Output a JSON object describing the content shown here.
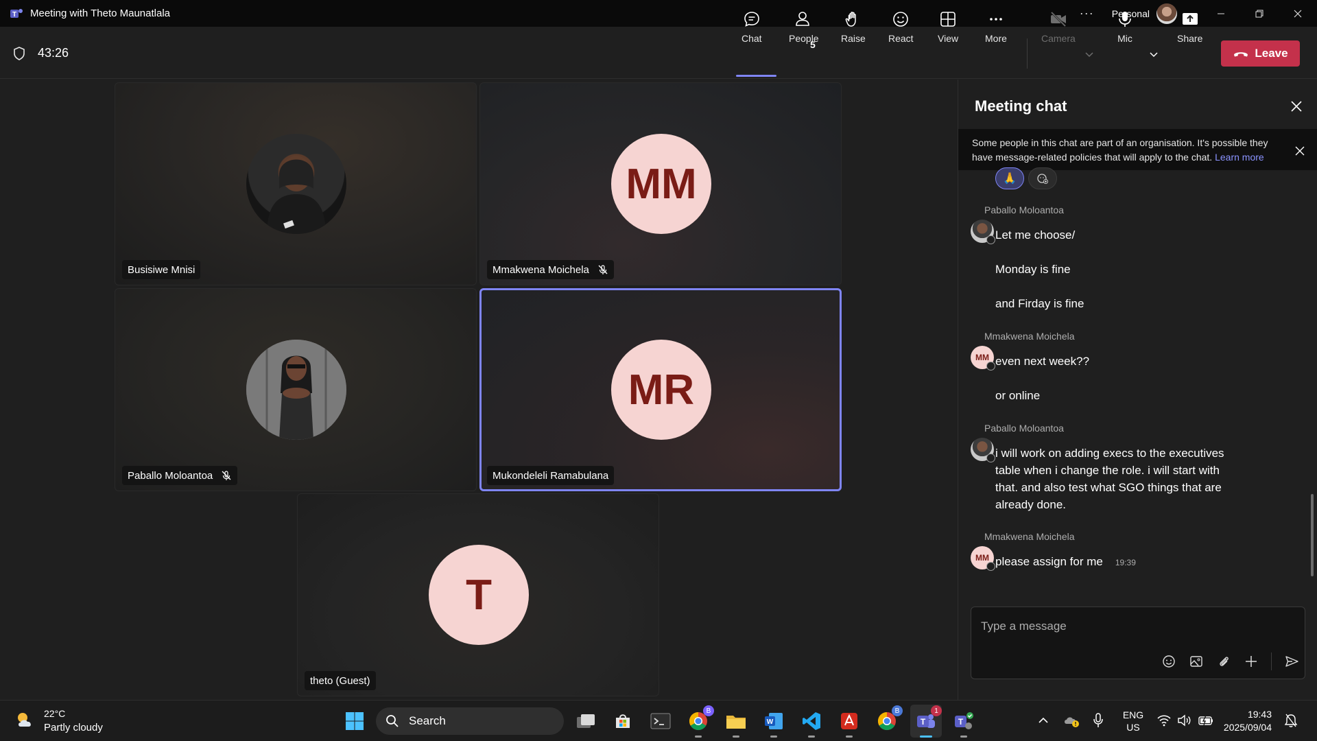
{
  "window": {
    "title": "Meeting with Theto Maunatlala",
    "more_label": "···",
    "account": "Personal"
  },
  "meeting": {
    "timer": "43:26",
    "toolbar": {
      "chat": "Chat",
      "people": "People",
      "people_count": "5",
      "raise": "Raise",
      "react": "React",
      "view": "View",
      "more": "More",
      "camera": "Camera",
      "mic": "Mic",
      "share": "Share",
      "leave": "Leave"
    }
  },
  "participants": [
    {
      "name": "Busisiwe Mnisi",
      "initials": "",
      "muted": false,
      "has_photo": true
    },
    {
      "name": "Mmakwena Moichela",
      "initials": "MM",
      "muted": true,
      "has_photo": false
    },
    {
      "name": "Paballo Moloantoa",
      "initials": "",
      "muted": true,
      "has_photo": true
    },
    {
      "name": "Mukondeleli Ramabulana",
      "initials": "MR",
      "muted": false,
      "has_photo": false,
      "speaking": true
    },
    {
      "name": "theto (Guest)",
      "initials": "T",
      "muted": false,
      "has_photo": false
    }
  ],
  "chat": {
    "title": "Meeting chat",
    "notice": "Some people in this chat are part of an organisation. It's possible they have message-related policies that will apply to the chat.",
    "notice_link": "Learn more",
    "reactions": [
      "🙏",
      "☺"
    ],
    "groups": [
      {
        "sender": "Paballo Moloantoa",
        "avatar": "photo",
        "messages": [
          "Let me choose/",
          "Monday is fine",
          "and Firday is fine"
        ]
      },
      {
        "sender": "Mmakwena Moichela",
        "avatar": "MM",
        "messages": [
          "even next week??",
          "or online"
        ]
      },
      {
        "sender": "Paballo Moloantoa",
        "avatar": "photo",
        "messages": [
          "i will work on adding execs to the executives",
          "table when i change the role. i will start with",
          "that. and also test what SGO things that are",
          "already done."
        ]
      },
      {
        "sender": "Mmakwena Moichela",
        "avatar": "MM",
        "messages": [
          "please assign for me"
        ],
        "time": "19:39"
      }
    ],
    "composer_placeholder": "Type a message"
  },
  "taskbar": {
    "weather_temp": "22°C",
    "weather_desc": "Partly cloudy",
    "search_label": "Search",
    "teams_badge": "1",
    "chrome_badge": "B",
    "lang_top": "ENG",
    "lang_bottom": "US",
    "time": "19:43",
    "date": "2025/09/04"
  },
  "colors": {
    "accent": "#7f85f5",
    "leave": "#c4314b",
    "avatar_bg": "#f6d4d2",
    "avatar_fg": "#7a1c16"
  }
}
